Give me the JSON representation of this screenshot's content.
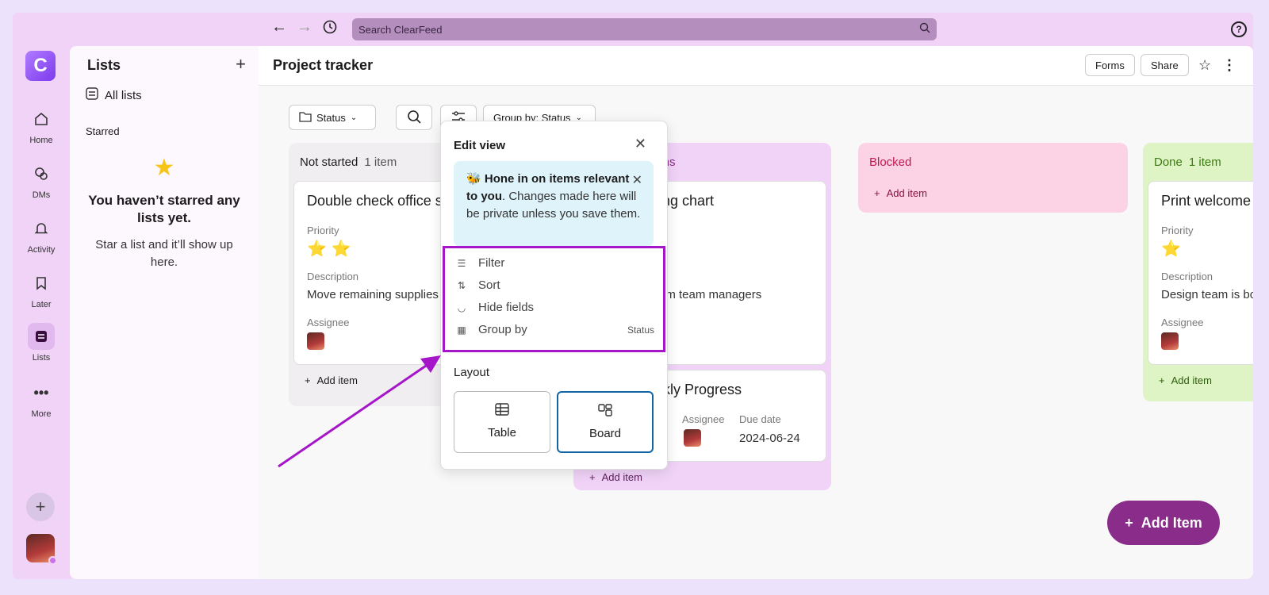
{
  "search": {
    "placeholder": "Search ClearFeed"
  },
  "rail": {
    "logo": "C",
    "items": [
      {
        "label": "Home"
      },
      {
        "label": "DMs"
      },
      {
        "label": "Activity"
      },
      {
        "label": "Later"
      },
      {
        "label": "Lists"
      },
      {
        "label": "More"
      }
    ]
  },
  "sidebar": {
    "title": "Lists",
    "all_lists": "All lists",
    "starred": "Starred",
    "empty_title": "You haven’t starred any lists yet.",
    "empty_sub": "Star a list and it’ll show up here."
  },
  "header": {
    "title": "Project tracker",
    "forms": "Forms",
    "share": "Share"
  },
  "toolbar": {
    "status": "Status",
    "group_by": "Group by: Status"
  },
  "columns": [
    {
      "name": "Not started",
      "count": "1 item",
      "color": "#f0eef0",
      "head_color": "#1d1c1d"
    },
    {
      "name": "",
      "count": "tems",
      "color": "#f1d3f8",
      "head_color": "#8a2d8a"
    },
    {
      "name": "Blocked",
      "count": "",
      "color": "#fbd3e4",
      "head_color": "#c4194f"
    },
    {
      "name": "Done",
      "count": "1 item",
      "color": "#dff4c4",
      "head_color": "#3c7a12"
    }
  ],
  "cards": {
    "c1": {
      "title": "Double check office s",
      "priority_label": "Priority",
      "stars": "⭐ ⭐",
      "desc_label": "Description",
      "desc": "Move remaining supplies",
      "assignee_label": "Assignee"
    },
    "c2": {
      "title": "ting chart",
      "desc": "rom team managers"
    },
    "c3": {
      "title": "ekly Progress",
      "assignee_label": "Assignee",
      "due_label": "Due date",
      "due": "2024-06-24"
    },
    "c4": {
      "title": "Print welcome",
      "priority_label": "Priority",
      "stars": "⭐",
      "desc_label": "Description",
      "desc": "Design team is bo",
      "assignee_label": "Assignee"
    }
  },
  "add_item": "Add item",
  "fab": "Add Item",
  "popover": {
    "title": "Edit view",
    "tip_emoji": "🐝",
    "tip_bold": "Hone in on items relevant to you",
    "tip_rest": ". Changes made here will be private unless you save them.",
    "options": [
      {
        "label": "Filter",
        "icon": "filter-icon"
      },
      {
        "label": "Sort",
        "icon": "sort-icon"
      },
      {
        "label": "Hide fields",
        "icon": "hide-icon"
      },
      {
        "label": "Group by",
        "icon": "group-icon",
        "meta": "Status"
      }
    ],
    "layout_label": "Layout",
    "layouts": [
      {
        "label": "Table"
      },
      {
        "label": "Board"
      }
    ]
  },
  "colors": {
    "accent": "#8a2d8a",
    "highlight": "#a516c9",
    "selected": "#1264a3"
  }
}
